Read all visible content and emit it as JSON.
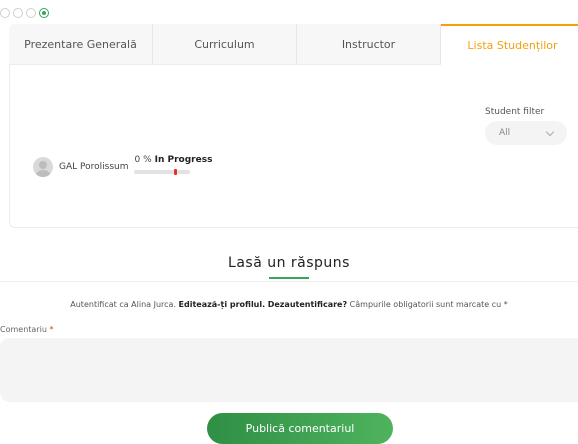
{
  "tabs": [
    {
      "label": "Prezentare Generală"
    },
    {
      "label": "Curriculum"
    },
    {
      "label": "Instructor"
    },
    {
      "label": "Lista Studenților"
    }
  ],
  "student_filter": {
    "label": "Student filter",
    "selected": "All"
  },
  "student": {
    "name": "GAL Porolissum",
    "percent": "0 %",
    "status": "In Progress",
    "progress_fraction": 0.0
  },
  "reply": {
    "title": "Lasă un răspuns",
    "logged_in_prefix": "Autentificat ca Alina Jurca.",
    "edit_profile_link": "Editează-ți profilul.",
    "logout_link": "Dezautentificare?",
    "required_note": "Câmpurile obligatorii sunt marcate cu",
    "required_mark": "*"
  },
  "comment": {
    "label": "Comentariu",
    "required_mark": "*",
    "value": ""
  },
  "submit": {
    "label": "Publică comentariul"
  },
  "colors": {
    "active_tab": "#f2a10d",
    "accent_green": "#3aa35a",
    "marker_red": "#e8302e"
  }
}
